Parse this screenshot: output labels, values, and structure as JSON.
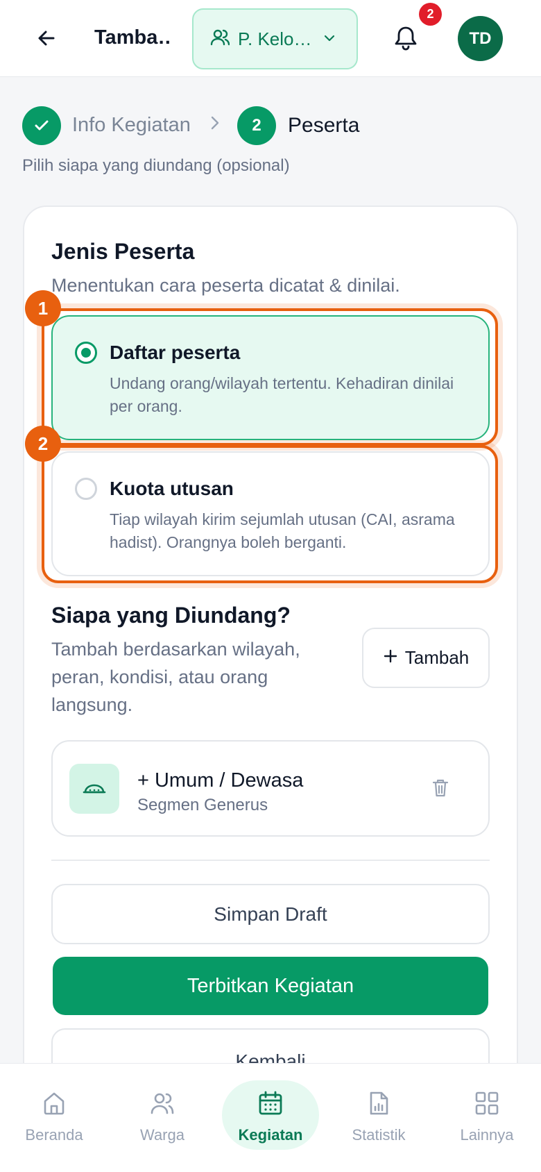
{
  "header": {
    "title": "Tamba…",
    "group_label": "P. Kelo…",
    "notification_count": "2",
    "avatar_initials": "TD"
  },
  "stepper": {
    "step1_label": "Info Kegiatan",
    "step2_number": "2",
    "step2_label": "Peserta",
    "subtitle": "Pilih siapa yang diundang (opsional)"
  },
  "participant_type": {
    "title": "Jenis Peserta",
    "description": "Menentukan cara peserta dicatat & dinilai.",
    "options": [
      {
        "title": "Daftar peserta",
        "description": "Undang orang/wilayah tertentu. Kehadiran dinilai per orang.",
        "selected": true,
        "marker": "1"
      },
      {
        "title": "Kuota utusan",
        "description": "Tiap wilayah kirim sejumlah utusan (CAI, asrama hadist). Orangnya boleh berganti.",
        "selected": false,
        "marker": "2"
      }
    ]
  },
  "invitees": {
    "title": "Siapa yang Diundang?",
    "description": "Tambah berdasarkan wilayah, peran, kondisi, atau orang langsung.",
    "add_label": "Tambah",
    "segment": {
      "title": "+ Umum / Dewasa",
      "subtitle": "Segmen Generus",
      "icon": "cap-icon"
    }
  },
  "actions": {
    "save_draft": "Simpan Draft",
    "publish": "Terbitkan Kegiatan",
    "back": "Kembali"
  },
  "bottom_nav": {
    "items": [
      {
        "label": "Beranda",
        "icon": "home-icon"
      },
      {
        "label": "Warga",
        "icon": "users-icon"
      },
      {
        "label": "Kegiatan",
        "icon": "calendar-icon",
        "active": true
      },
      {
        "label": "Statistik",
        "icon": "chart-file-icon"
      },
      {
        "label": "Lainnya",
        "icon": "grid-icon"
      }
    ]
  },
  "colors": {
    "primary": "#079a66",
    "highlight": "#e8600f",
    "badge": "#e11d2a"
  }
}
